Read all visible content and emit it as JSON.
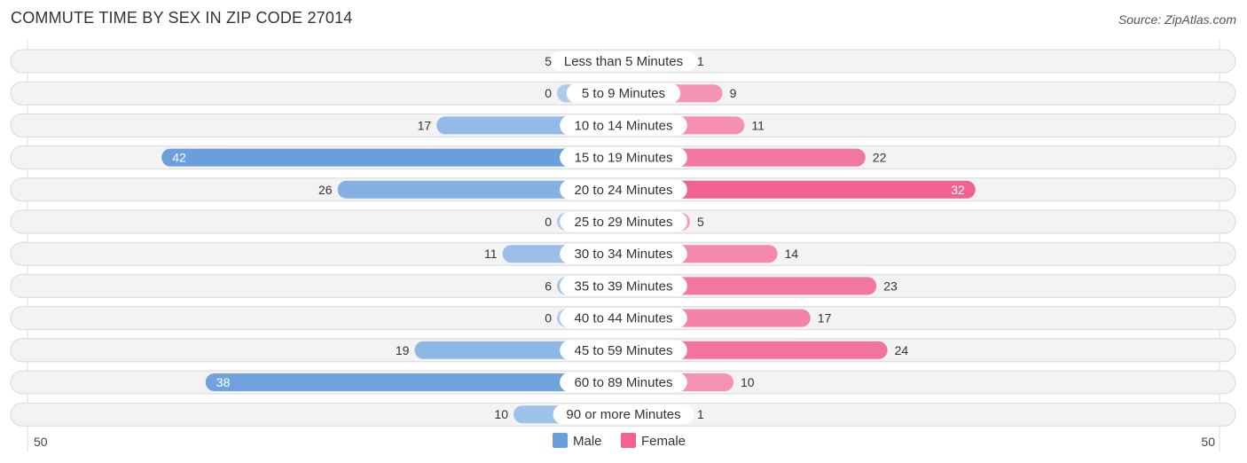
{
  "header": {
    "title": "COMMUTE TIME BY SEX IN ZIP CODE 27014",
    "source": "Source: ZipAtlas.com"
  },
  "chart_data": {
    "type": "bar",
    "orientation": "horizontal-diverging",
    "title": "COMMUTE TIME BY SEX IN ZIP CODE 27014",
    "categories": [
      "Less than 5 Minutes",
      "5 to 9 Minutes",
      "10 to 14 Minutes",
      "15 to 19 Minutes",
      "20 to 24 Minutes",
      "25 to 29 Minutes",
      "30 to 34 Minutes",
      "35 to 39 Minutes",
      "40 to 44 Minutes",
      "45 to 59 Minutes",
      "60 to 89 Minutes",
      "90 or more Minutes"
    ],
    "series": [
      {
        "name": "Male",
        "side": "left",
        "color": "#6a9fdc",
        "color_light": "#aecbee",
        "values": [
          5,
          0,
          17,
          42,
          26,
          0,
          11,
          6,
          0,
          19,
          38,
          10
        ]
      },
      {
        "name": "Female",
        "side": "right",
        "color": "#f06292",
        "color_light": "#f7a8c2",
        "values": [
          1,
          9,
          11,
          22,
          32,
          5,
          14,
          23,
          17,
          24,
          10,
          1
        ]
      }
    ],
    "axis": {
      "left_label": "50",
      "right_label": "50",
      "max": 50
    },
    "legend": {
      "position": "bottom-center",
      "items": [
        "Male",
        "Female"
      ]
    }
  }
}
